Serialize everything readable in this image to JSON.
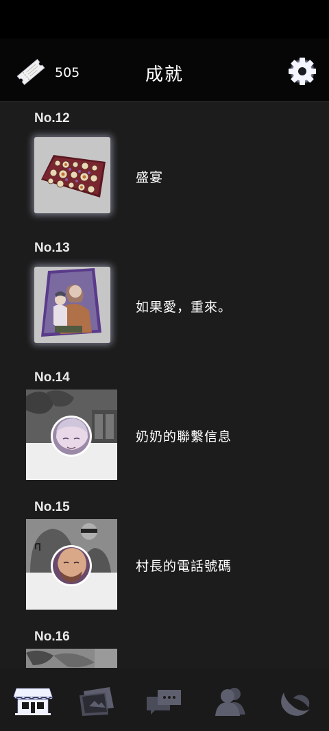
{
  "header": {
    "ticket_count": "505",
    "title": "成就",
    "ticket_icon": "ticket-icon",
    "settings_icon": "gear-icon"
  },
  "achievements": [
    {
      "no": "No.12",
      "name": "盛宴",
      "image": "feast-table"
    },
    {
      "no": "No.13",
      "name": "如果愛，重來。",
      "image": "family-photo"
    },
    {
      "no": "No.14",
      "name": "奶奶的聯繫信息",
      "image": "grandma-portrait"
    },
    {
      "no": "No.15",
      "name": "村長的電話號碼",
      "image": "village-chief-portrait"
    },
    {
      "no": "No.16",
      "name": "",
      "image": "partial-scene"
    }
  ],
  "bottom_nav": [
    {
      "icon": "shop-icon",
      "active": true
    },
    {
      "icon": "cards-icon",
      "active": false
    },
    {
      "icon": "chat-icon",
      "active": false
    },
    {
      "icon": "people-icon",
      "active": false
    },
    {
      "icon": "moon-icon",
      "active": false
    }
  ],
  "colors": {
    "background": "#1c1c1c",
    "header": "#060606",
    "accent_glow": "#dce1ff",
    "inactive_icon": "#5d5f6e"
  }
}
